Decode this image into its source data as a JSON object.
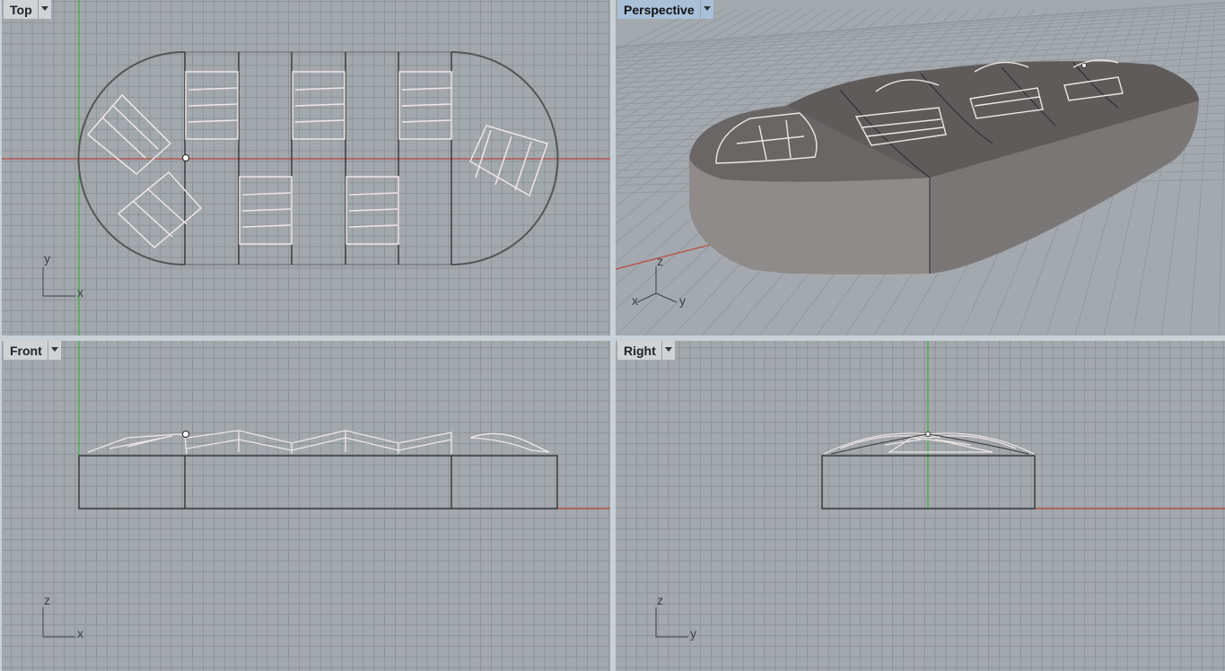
{
  "viewports": {
    "top": {
      "title": "Top",
      "axis_h": "x",
      "axis_v": "y"
    },
    "perspective": {
      "title": "Perspective",
      "axis_1": "z",
      "axis_2": "x",
      "axis_3": "y"
    },
    "front": {
      "title": "Front",
      "axis_h": "x",
      "axis_v": "z"
    },
    "right": {
      "title": "Right",
      "axis_h": "y",
      "axis_v": "z"
    }
  },
  "active_viewport": "Perspective",
  "colors": {
    "x_axis": "#b84a3e",
    "y_axis": "#3cae3c",
    "grid_bg": "#a3a8ad",
    "grid_line": "#8e9398",
    "label_bg": "#cfd3d6",
    "active_label_bg": "#a9c0d9",
    "skylight": "#efe6e6",
    "model_outline": "#4a4a4a"
  }
}
